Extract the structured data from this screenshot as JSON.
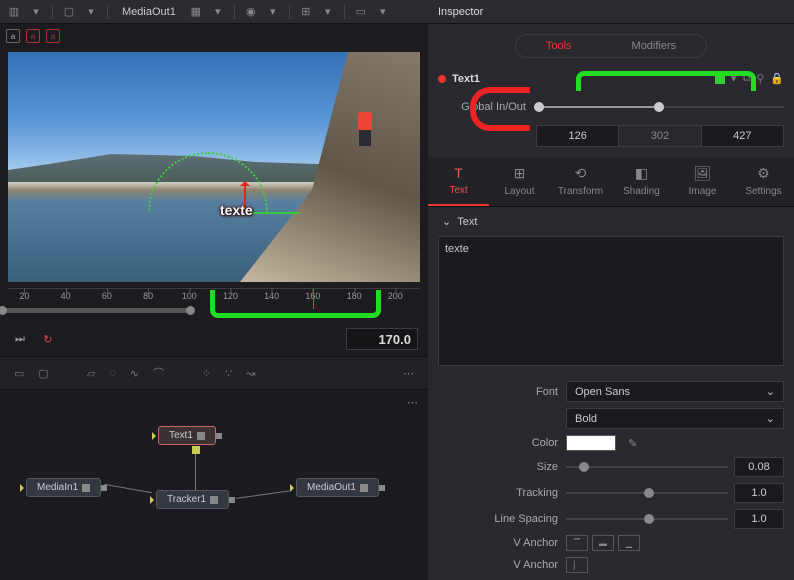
{
  "toolbar": {
    "media_label": "MediaOut1"
  },
  "viewer": {
    "overlay_text": "texte"
  },
  "timeline": {
    "ticks": [
      20,
      40,
      60,
      80,
      100,
      120,
      140,
      160,
      180,
      200
    ],
    "playhead": 160,
    "frame_value": "170.0"
  },
  "nodes": {
    "text1": "Text1",
    "mediain1": "MediaIn1",
    "tracker1": "Tracker1",
    "mediaout1": "MediaOut1"
  },
  "inspector": {
    "title": "Inspector",
    "tabs": {
      "tools": "Tools",
      "modifiers": "Modifiers"
    },
    "node_title": "Text1",
    "global": {
      "label": "Global In/Out",
      "in": "126",
      "mid": "302",
      "out": "427"
    },
    "prop_tabs": {
      "text": "Text",
      "layout": "Layout",
      "transform": "Transform",
      "shading": "Shading",
      "image": "Image",
      "settings": "Settings"
    },
    "section_text": "Text",
    "text_value": "texte",
    "font": {
      "label": "Font",
      "family": "Open Sans",
      "weight": "Bold"
    },
    "color_label": "Color",
    "size": {
      "label": "Size",
      "value": "0.08"
    },
    "tracking": {
      "label": "Tracking",
      "value": "1.0"
    },
    "line_spacing": {
      "label": "Line Spacing",
      "value": "1.0"
    },
    "v_anchor_label": "V Anchor",
    "h_anchor_label": "V Anchor"
  }
}
